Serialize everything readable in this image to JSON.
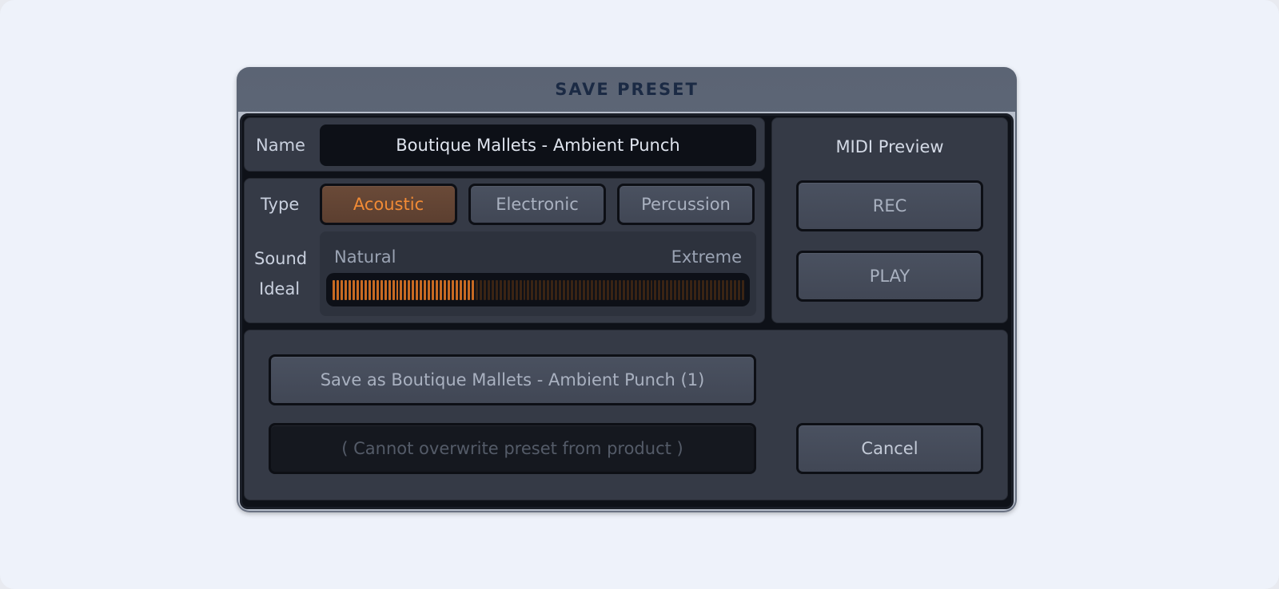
{
  "dialog": {
    "title": "SAVE PRESET"
  },
  "name": {
    "label": "Name",
    "value": "Boutique Mallets - Ambient Punch"
  },
  "type": {
    "label": "Type",
    "options": [
      "Acoustic",
      "Electronic",
      "Percussion"
    ],
    "selected": "Acoustic"
  },
  "sound_ideal": {
    "label_line1": "Sound",
    "label_line2": "Ideal",
    "min_label": "Natural",
    "max_label": "Extreme",
    "level": 0.35
  },
  "midi_preview": {
    "title": "MIDI Preview",
    "rec_label": "REC",
    "play_label": "PLAY"
  },
  "actions": {
    "save_as_label": "Save as Boutique Mallets - Ambient Punch (1)",
    "overwrite_label": "( Cannot overwrite preset from product )",
    "cancel_label": "Cancel"
  },
  "colors": {
    "accent": "#f28b35",
    "meter_on": "#c86a22",
    "meter_off": "#3a2414"
  }
}
